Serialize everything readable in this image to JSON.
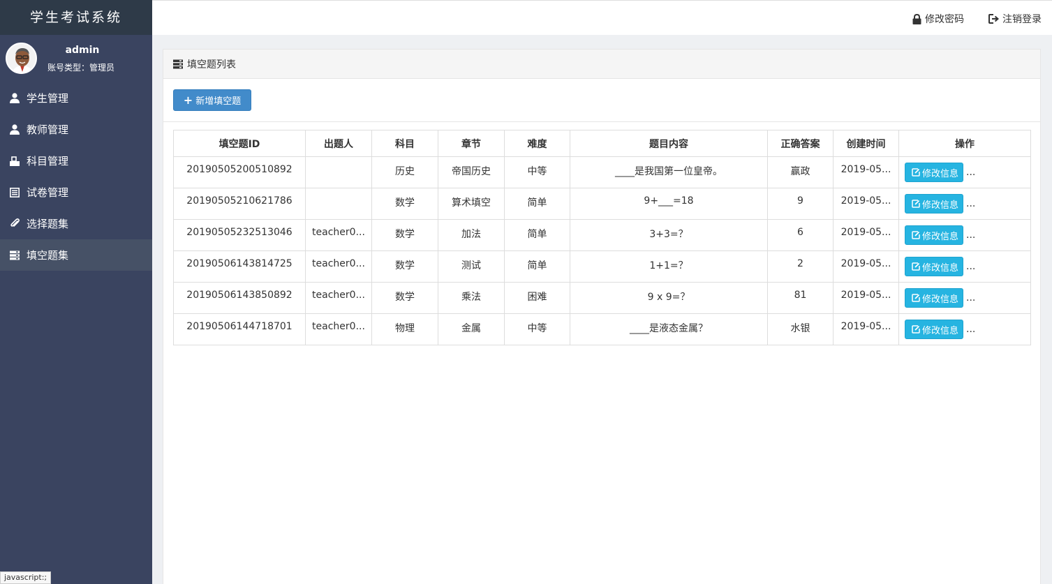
{
  "app": {
    "title": "学生考试系统"
  },
  "user": {
    "name": "admin",
    "role": "账号类型：管理员"
  },
  "sidebar": {
    "items": [
      {
        "label": "学生管理",
        "icon": "user-icon"
      },
      {
        "label": "教师管理",
        "icon": "user-icon"
      },
      {
        "label": "科目管理",
        "icon": "inbox-icon"
      },
      {
        "label": "试卷管理",
        "icon": "list-icon"
      },
      {
        "label": "选择题集",
        "icon": "paperclip-icon"
      },
      {
        "label": "填空题集",
        "icon": "tasks-icon",
        "active": true
      }
    ]
  },
  "topbar": {
    "change_password": "修改密码",
    "logout": "注销登录"
  },
  "panel": {
    "title": "填空题列表",
    "add_button": "新增填空题"
  },
  "table": {
    "headers": [
      "填空题ID",
      "出题人",
      "科目",
      "章节",
      "难度",
      "题目内容",
      "正确答案",
      "创建时间",
      "操作"
    ],
    "rows": [
      {
        "id": "20190505200510892",
        "author": "",
        "subject": "历史",
        "chapter": "帝国历史",
        "difficulty": "中等",
        "content": "____是我国第一位皇帝。",
        "answer": "赢政",
        "created": "2019-05..."
      },
      {
        "id": "20190505210621786",
        "author": "",
        "subject": "数学",
        "chapter": "算术填空",
        "difficulty": "简单",
        "content": "9+___=18",
        "answer": "9",
        "created": "2019-05..."
      },
      {
        "id": "20190505232513046",
        "author": "teacher0...",
        "subject": "数学",
        "chapter": "加法",
        "difficulty": "简单",
        "content": "3+3=？",
        "answer": "6",
        "created": "2019-05..."
      },
      {
        "id": "20190506143814725",
        "author": "teacher0...",
        "subject": "数学",
        "chapter": "测试",
        "difficulty": "简单",
        "content": "1+1=？",
        "answer": "2",
        "created": "2019-05..."
      },
      {
        "id": "20190506143850892",
        "author": "teacher0...",
        "subject": "数学",
        "chapter": "乘法",
        "difficulty": "困难",
        "content": "9 x 9=？",
        "answer": "81",
        "created": "2019-05..."
      },
      {
        "id": "20190506144718701",
        "author": "teacher0...",
        "subject": "物理",
        "chapter": "金属",
        "difficulty": "中等",
        "content": "____是液态金属？",
        "answer": "水银",
        "created": "2019-05..."
      }
    ],
    "edit_label": "修改信息",
    "more_label": "..."
  },
  "status_bar": "javascript:;",
  "colors": {
    "sidebar": "#3a4460",
    "brand": "#2e3a48",
    "primary": "#428bca",
    "info": "#26b4e1"
  }
}
